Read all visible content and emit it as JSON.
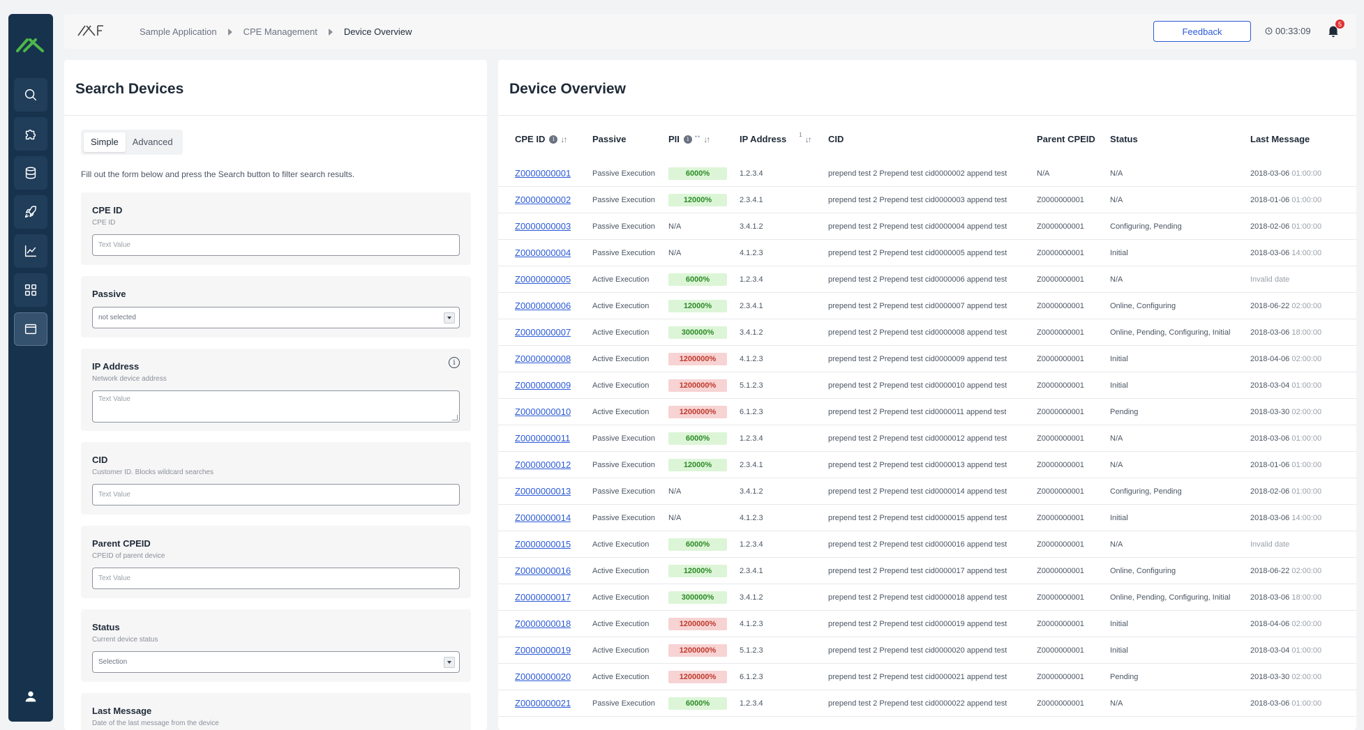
{
  "sidebar": {
    "logo": "AX",
    "items": [
      {
        "icon": "search-icon"
      },
      {
        "icon": "puzzle-icon"
      },
      {
        "icon": "database-icon"
      },
      {
        "icon": "rocket-icon"
      },
      {
        "icon": "chart-icon"
      },
      {
        "icon": "grid-icon"
      },
      {
        "icon": "window-icon",
        "active": true
      }
    ],
    "footer_icon": "user-icon"
  },
  "topbar": {
    "brand": "AXF",
    "breadcrumbs": [
      "Sample Application",
      "CPE Management",
      "Device Overview"
    ],
    "feedback_label": "Feedback",
    "timer": "00:33:09",
    "notifications": "5"
  },
  "search": {
    "title": "Search Devices",
    "modes": [
      "Simple",
      "Advanced"
    ],
    "active_mode": "Simple",
    "intro": "Fill out the form below and press the Search button to filter search results.",
    "fields": {
      "cpe_id": {
        "label": "CPE ID",
        "help": "CPE ID",
        "placeholder": "Text Value"
      },
      "passive": {
        "label": "Passive",
        "value": "not selected"
      },
      "ip": {
        "label": "IP Address",
        "help": "Network device address",
        "placeholder": "Text Value"
      },
      "cid": {
        "label": "CID",
        "help": "Customer ID. Blocks wildcard searches",
        "placeholder": "Text Value"
      },
      "parent": {
        "label": "Parent CPEID",
        "help": "CPEID of parent device",
        "placeholder": "Text Value"
      },
      "status": {
        "label": "Status",
        "help": "Current device status",
        "value": "Selection"
      },
      "last_message": {
        "label": "Last Message",
        "help": "Date of the last message from the device"
      }
    }
  },
  "overview": {
    "title": "Device Overview",
    "columns": {
      "cpe_id": "CPE ID",
      "passive": "Passive",
      "pii": "PII",
      "ip": "IP Address",
      "ip_sort_index": "1",
      "cid": "CID",
      "parent": "Parent CPEID",
      "status": "Status",
      "last_message": "Last Message"
    },
    "rows": [
      {
        "id": "Z0000000001",
        "passive": "Passive Execution",
        "pii": "6000%",
        "pii_state": "good",
        "ip": "1.2.3.4",
        "cid": "prepend test 2 Prepend test cid0000002 append test",
        "parent": "N/A",
        "status": "N/A",
        "date": "2018-03-06",
        "time": "01:00:00"
      },
      {
        "id": "Z0000000002",
        "passive": "Passive Execution",
        "pii": "12000%",
        "pii_state": "good",
        "ip": "2.3.4.1",
        "cid": "prepend test 2 Prepend test cid0000003 append test",
        "parent": "Z0000000001",
        "status": "N/A",
        "date": "2018-01-06",
        "time": "01:00:00"
      },
      {
        "id": "Z0000000003",
        "passive": "Passive Execution",
        "pii": "N/A",
        "pii_state": "none",
        "ip": "3.4.1.2",
        "cid": "prepend test 2 Prepend test cid0000004 append test",
        "parent": "Z0000000001",
        "status": "Configuring, Pending",
        "date": "2018-02-06",
        "time": "01:00:00"
      },
      {
        "id": "Z0000000004",
        "passive": "Passive Execution",
        "pii": "N/A",
        "pii_state": "none",
        "ip": "4.1.2.3",
        "cid": "prepend test 2 Prepend test cid0000005 append test",
        "parent": "Z0000000001",
        "status": "Initial",
        "date": "2018-03-06",
        "time": "14:00:00"
      },
      {
        "id": "Z0000000005",
        "passive": "Active Execution",
        "pii": "6000%",
        "pii_state": "good",
        "ip": "1.2.3.4",
        "cid": "prepend test 2 Prepend test cid0000006 append test",
        "parent": "Z0000000001",
        "status": "N/A",
        "date": "Invalid date",
        "time": ""
      },
      {
        "id": "Z0000000006",
        "passive": "Active Execution",
        "pii": "12000%",
        "pii_state": "good",
        "ip": "2.3.4.1",
        "cid": "prepend test 2 Prepend test cid0000007 append test",
        "parent": "Z0000000001",
        "status": "Online, Configuring",
        "date": "2018-06-22",
        "time": "02:00:00"
      },
      {
        "id": "Z0000000007",
        "passive": "Active Execution",
        "pii": "300000%",
        "pii_state": "good",
        "ip": "3.4.1.2",
        "cid": "prepend test 2 Prepend test cid0000008 append test",
        "parent": "Z0000000001",
        "status": "Online, Pending, Configuring, Initial",
        "date": "2018-03-06",
        "time": "18:00:00"
      },
      {
        "id": "Z0000000008",
        "passive": "Active Execution",
        "pii": "1200000%",
        "pii_state": "bad",
        "ip": "4.1.2.3",
        "cid": "prepend test 2 Prepend test cid0000009 append test",
        "parent": "Z0000000001",
        "status": "Initial",
        "date": "2018-04-06",
        "time": "02:00:00"
      },
      {
        "id": "Z0000000009",
        "passive": "Active Execution",
        "pii": "1200000%",
        "pii_state": "bad",
        "ip": "5.1.2.3",
        "cid": "prepend test 2 Prepend test cid0000010 append test",
        "parent": "Z0000000001",
        "status": "Initial",
        "date": "2018-03-04",
        "time": "01:00:00"
      },
      {
        "id": "Z0000000010",
        "passive": "Active Execution",
        "pii": "1200000%",
        "pii_state": "bad",
        "ip": "6.1.2.3",
        "cid": "prepend test 2 Prepend test cid0000011 append test",
        "parent": "Z0000000001",
        "status": "Pending",
        "date": "2018-03-30",
        "time": "02:00:00"
      },
      {
        "id": "Z0000000011",
        "passive": "Passive Execution",
        "pii": "6000%",
        "pii_state": "good",
        "ip": "1.2.3.4",
        "cid": "prepend test 2 Prepend test cid0000012 append test",
        "parent": "Z0000000001",
        "status": "N/A",
        "date": "2018-03-06",
        "time": "01:00:00"
      },
      {
        "id": "Z0000000012",
        "passive": "Passive Execution",
        "pii": "12000%",
        "pii_state": "good",
        "ip": "2.3.4.1",
        "cid": "prepend test 2 Prepend test cid0000013 append test",
        "parent": "Z0000000001",
        "status": "N/A",
        "date": "2018-01-06",
        "time": "01:00:00"
      },
      {
        "id": "Z0000000013",
        "passive": "Passive Execution",
        "pii": "N/A",
        "pii_state": "none",
        "ip": "3.4.1.2",
        "cid": "prepend test 2 Prepend test cid0000014 append test",
        "parent": "Z0000000001",
        "status": "Configuring, Pending",
        "date": "2018-02-06",
        "time": "01:00:00"
      },
      {
        "id": "Z0000000014",
        "passive": "Passive Execution",
        "pii": "N/A",
        "pii_state": "none",
        "ip": "4.1.2.3",
        "cid": "prepend test 2 Prepend test cid0000015 append test",
        "parent": "Z0000000001",
        "status": "Initial",
        "date": "2018-03-06",
        "time": "14:00:00"
      },
      {
        "id": "Z0000000015",
        "passive": "Active Execution",
        "pii": "6000%",
        "pii_state": "good",
        "ip": "1.2.3.4",
        "cid": "prepend test 2 Prepend test cid0000016 append test",
        "parent": "Z0000000001",
        "status": "N/A",
        "date": "Invalid date",
        "time": ""
      },
      {
        "id": "Z0000000016",
        "passive": "Active Execution",
        "pii": "12000%",
        "pii_state": "good",
        "ip": "2.3.4.1",
        "cid": "prepend test 2 Prepend test cid0000017 append test",
        "parent": "Z0000000001",
        "status": "Online, Configuring",
        "date": "2018-06-22",
        "time": "02:00:00"
      },
      {
        "id": "Z0000000017",
        "passive": "Active Execution",
        "pii": "300000%",
        "pii_state": "good",
        "ip": "3.4.1.2",
        "cid": "prepend test 2 Prepend test cid0000018 append test",
        "parent": "Z0000000001",
        "status": "Online, Pending, Configuring, Initial",
        "date": "2018-03-06",
        "time": "18:00:00"
      },
      {
        "id": "Z0000000018",
        "passive": "Active Execution",
        "pii": "1200000%",
        "pii_state": "bad",
        "ip": "4.1.2.3",
        "cid": "prepend test 2 Prepend test cid0000019 append test",
        "parent": "Z0000000001",
        "status": "Initial",
        "date": "2018-04-06",
        "time": "02:00:00"
      },
      {
        "id": "Z0000000019",
        "passive": "Active Execution",
        "pii": "1200000%",
        "pii_state": "bad",
        "ip": "5.1.2.3",
        "cid": "prepend test 2 Prepend test cid0000020 append test",
        "parent": "Z0000000001",
        "status": "Initial",
        "date": "2018-03-04",
        "time": "01:00:00"
      },
      {
        "id": "Z0000000020",
        "passive": "Active Execution",
        "pii": "1200000%",
        "pii_state": "bad",
        "ip": "6.1.2.3",
        "cid": "prepend test 2 Prepend test cid0000021 append test",
        "parent": "Z0000000001",
        "status": "Pending",
        "date": "2018-03-30",
        "time": "02:00:00"
      },
      {
        "id": "Z0000000021",
        "passive": "Passive Execution",
        "pii": "6000%",
        "pii_state": "good",
        "ip": "1.2.3.4",
        "cid": "prepend test 2 Prepend test cid0000022 append test",
        "parent": "Z0000000001",
        "status": "N/A",
        "date": "2018-03-06",
        "time": "01:00:00"
      }
    ]
  },
  "colors": {
    "sidebar": "#17324d",
    "accent": "#2a5ad6",
    "brand_green": "#4cb848",
    "pill_good_bg": "#dcf5d7",
    "pill_bad_bg": "#f7d3d3"
  }
}
